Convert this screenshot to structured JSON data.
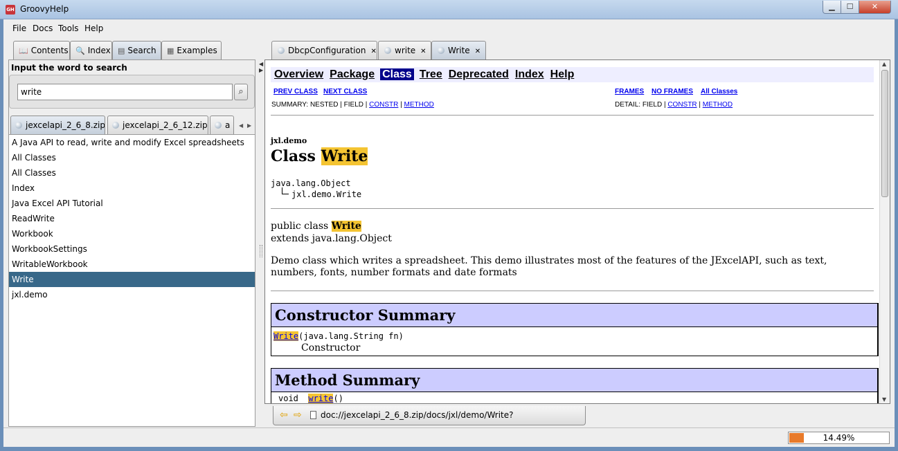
{
  "window": {
    "title": "GroovyHelp",
    "app_icon": "GH",
    "minimize": "▁",
    "maximize": "☐",
    "close": "✕"
  },
  "menu": [
    "File",
    "Docs",
    "Tools",
    "Help"
  ],
  "nav_tabs": [
    {
      "label": "Contents",
      "icon": "book-icon"
    },
    {
      "label": "Index",
      "icon": "magnifier-icon"
    },
    {
      "label": "Search",
      "icon": "search-doc-icon"
    },
    {
      "label": "Examples",
      "icon": "examples-icon"
    }
  ],
  "search": {
    "prompt": "Input the word to search",
    "value": "write",
    "button_icon": "search-icon"
  },
  "zip_tabs": [
    "jexcelapi_2_6_8.zip",
    "jexcelapi_2_6_12.zip",
    "a"
  ],
  "results": [
    "A Java API to read, write and modify Excel spreadsheets",
    "All Classes",
    "All Classes",
    "Index",
    "Java Excel API Tutorial",
    "ReadWrite",
    "Workbook",
    "WorkbookSettings",
    "WritableWorkbook",
    "Write",
    "jxl.demo"
  ],
  "selected_result": "Write",
  "doc_tabs": [
    {
      "label": "DbcpConfiguration",
      "close": "✕"
    },
    {
      "label": "write",
      "close": "✕"
    },
    {
      "label": "Write",
      "close": "✕"
    }
  ],
  "doc": {
    "navbar": [
      "Overview",
      "Package",
      "Class",
      "Tree",
      "Deprecated",
      "Index",
      "Help"
    ],
    "current_nav": "Class",
    "prev_class": "PREV CLASS",
    "next_class": "NEXT CLASS",
    "frames": "FRAMES",
    "no_frames": "NO FRAMES",
    "all_classes": "All Classes",
    "summary_prefix": "SUMMARY: NESTED | FIELD | ",
    "detail_prefix": "DETAIL: FIELD | ",
    "constr": "CONSTR",
    "method": "METHOD",
    "sep": " | ",
    "package": "jxl.demo",
    "class_word": "Class ",
    "class_name": "Write",
    "hierarchy_parent": "java.lang.Object",
    "hierarchy_child": "jxl.demo.Write",
    "decl_prefix": "public class ",
    "decl_extends": "extends java.lang.Object",
    "description": "Demo class which writes a spreadsheet. This demo illustrates most of the features of the JExcelAPI, such as text, numbers, fonts, number formats and date formats",
    "constructor_summary": "Constructor Summary",
    "ctor_name": "Write",
    "ctor_params": "(java.lang.String fn)",
    "ctor_desc": "Constructor",
    "method_summary": "Method Summary",
    "method_first_type": "void",
    "method_first_name": "write",
    "method_first_params": "()"
  },
  "address": {
    "url": "doc://jexcelapi_2_6_8.zip/docs/jxl/demo/Write?wordToHighlight=write"
  },
  "progress": {
    "value": 14.49,
    "label": "14.49%",
    "color": "#e87a2a"
  }
}
